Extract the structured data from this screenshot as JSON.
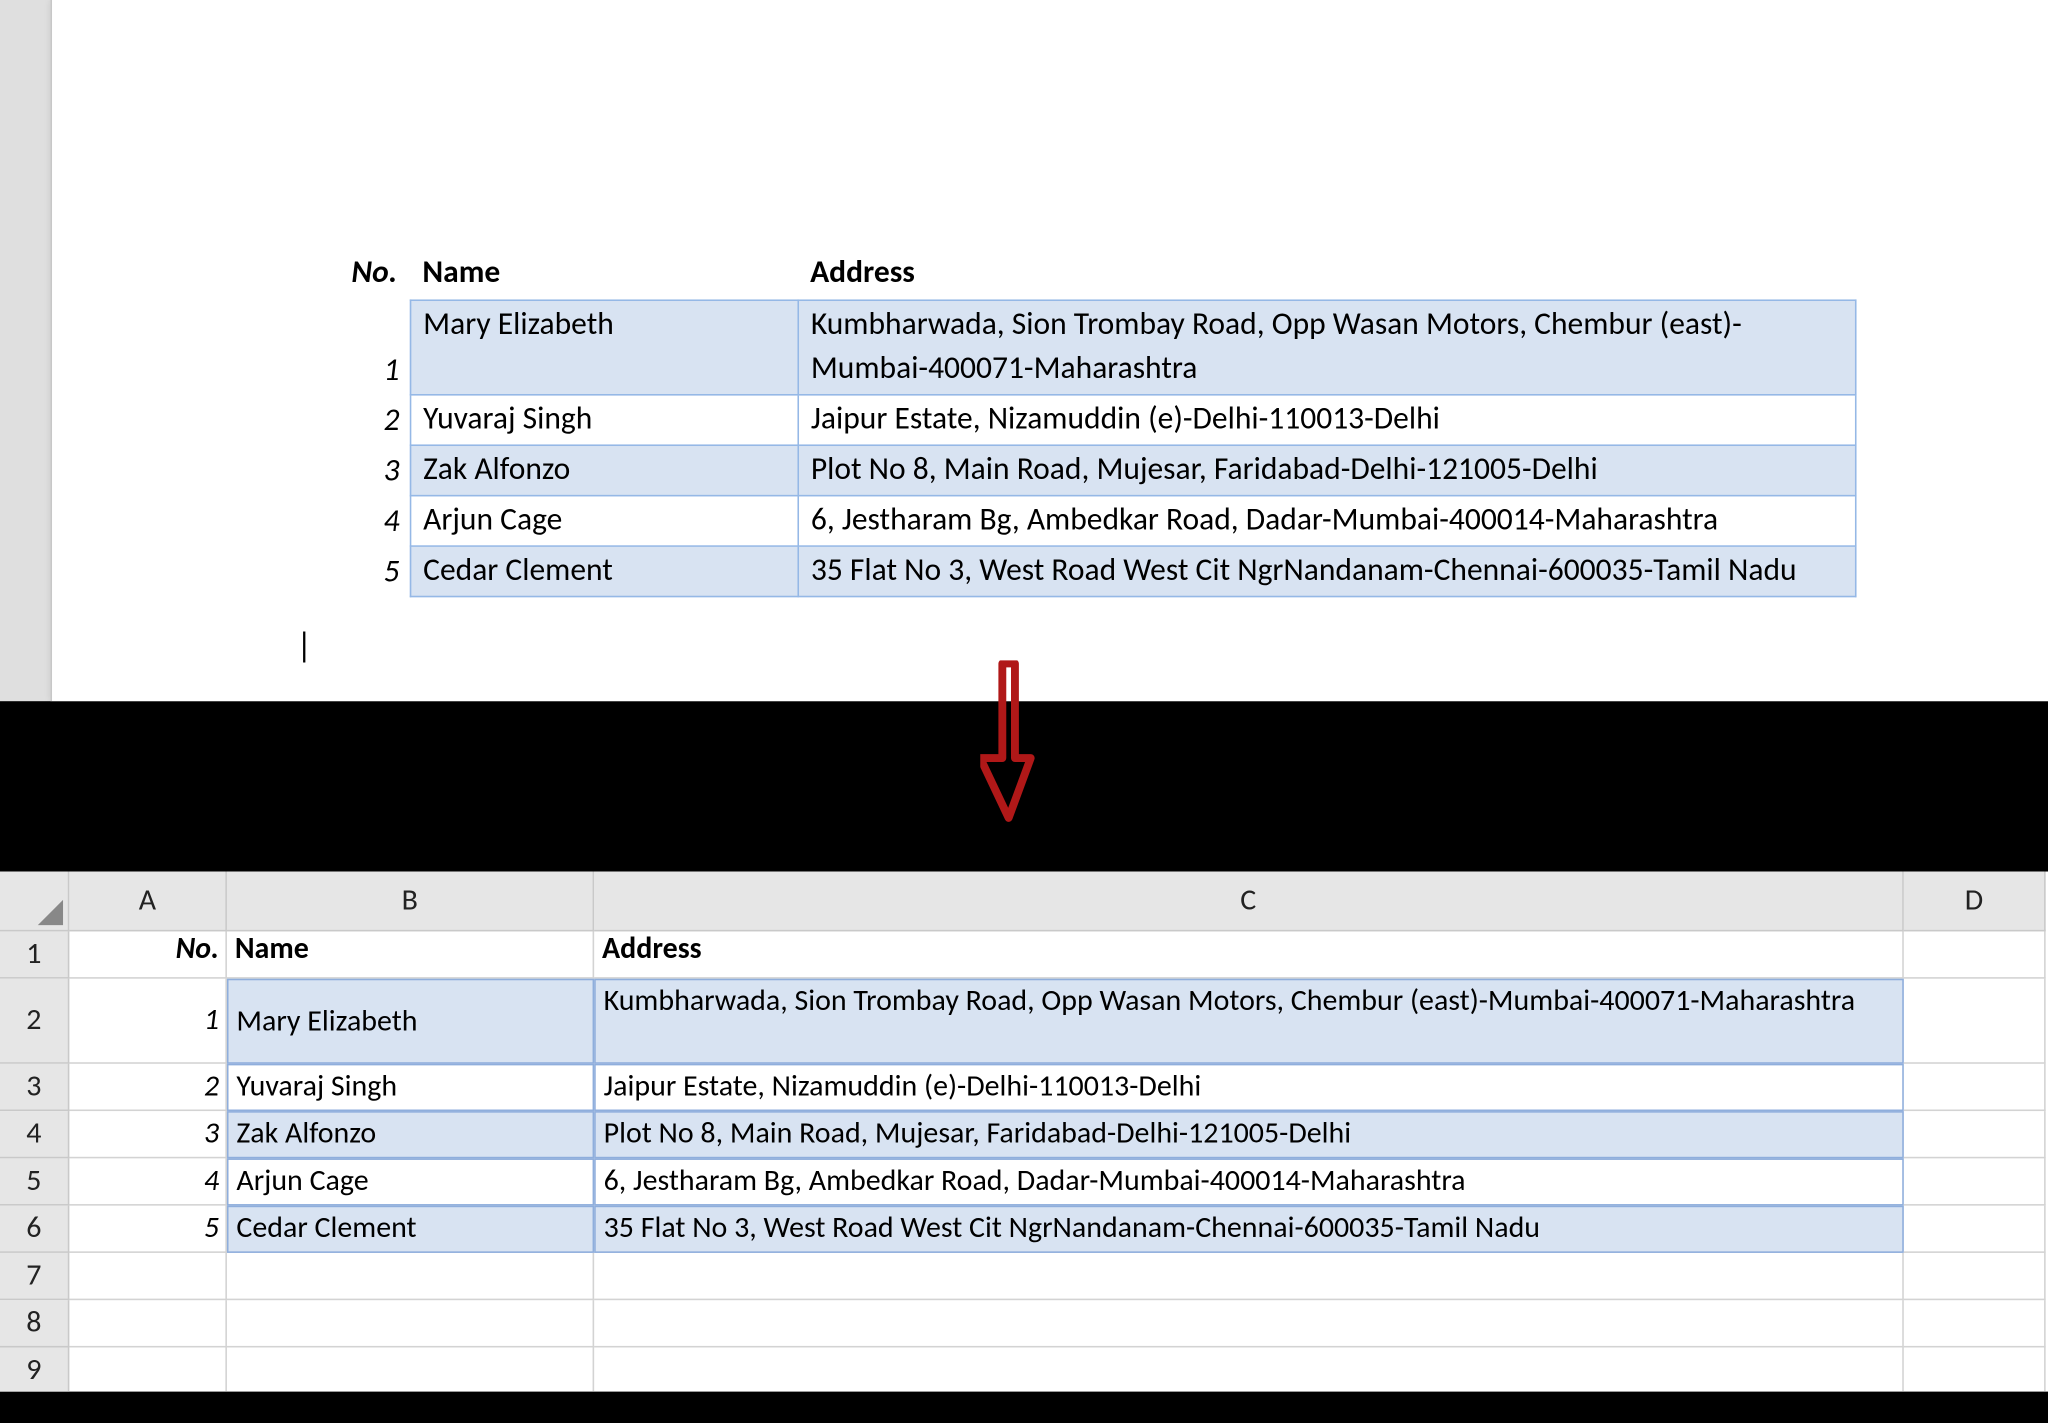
{
  "columns": {
    "no": "No.",
    "name": "Name",
    "address": "Address"
  },
  "rows": [
    {
      "no": "1",
      "name": "Mary Elizabeth",
      "address": "Kumbharwada, Sion Trombay Road, Opp Wasan Motors, Chembur (east)-Mumbai-400071-Maharashtra"
    },
    {
      "no": "2",
      "name": "Yuvaraj Singh",
      "address": "Jaipur Estate, Nizamuddin (e)-Delhi-110013-Delhi"
    },
    {
      "no": "3",
      "name": "Zak Alfonzo",
      "address": "Plot No 8, Main Road, Mujesar, Faridabad-Delhi-121005-Delhi"
    },
    {
      "no": "4",
      "name": "Arjun Cage",
      "address": "6, Jestharam Bg, Ambedkar Road, Dadar-Mumbai-400014-Maharashtra"
    },
    {
      "no": "5",
      "name": "Cedar Clement",
      "address": "35 Flat No 3, West Road West Cit NgrNandanam-Chennai-600035-Tamil Nadu"
    }
  ],
  "excel": {
    "col_letters": [
      "A",
      "B",
      "C",
      "D"
    ],
    "row_numbers": [
      "1",
      "2",
      "3",
      "4",
      "5",
      "6",
      "7",
      "8",
      "9"
    ]
  }
}
